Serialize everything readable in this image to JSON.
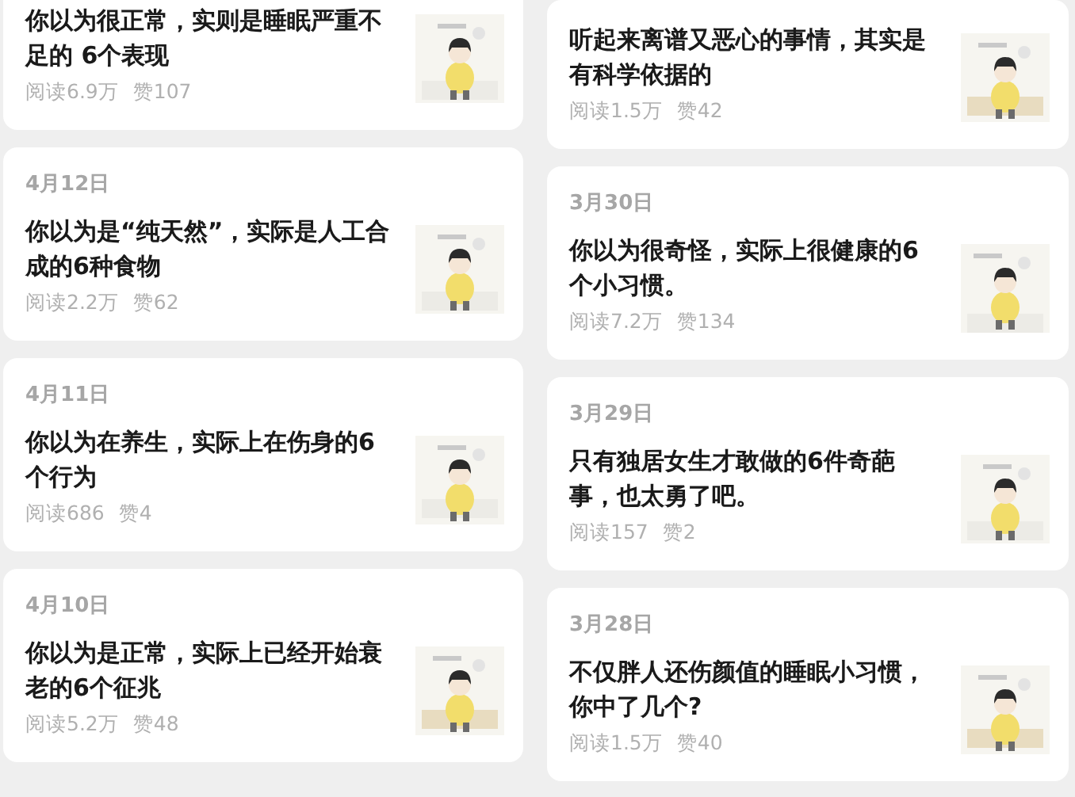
{
  "columns": [
    {
      "cards": [
        {
          "title": "你以为很正常，实则是睡眠严重不足的 6个表现",
          "reads": "阅读6.9万",
          "likes": "赞107"
        },
        {
          "date": "4月12日",
          "title": "你以为是“纯天然”，实际是人工合成的6种食物",
          "reads": "阅读2.2万",
          "likes": "赞62"
        },
        {
          "date": "4月11日",
          "title": "你以为在养生，实际上在伤身的6个行为",
          "reads": "阅读686",
          "likes": "赞4"
        },
        {
          "date": "4月10日",
          "title": "你以为是正常，实际上已经开始衰老的6个征兆",
          "reads": "阅读5.2万",
          "likes": "赞48"
        }
      ]
    },
    {
      "cards": [
        {
          "title": "听起来离谱又恶心的事情，其实是有科学依据的",
          "reads": "阅读1.5万",
          "likes": "赞42"
        },
        {
          "date": "3月30日",
          "title": "你以为很奇怪，实际上很健康的6个小习惯。",
          "reads": "阅读7.2万",
          "likes": "赞134"
        },
        {
          "date": "3月29日",
          "title": "只有独居女生才敢做的6件奇葩事，也太勇了吧。",
          "reads": "阅读157",
          "likes": "赞2"
        },
        {
          "date": "3月28日",
          "title": "不仅胖人还伤颜值的睡眠小习惯，你中了几个?",
          "reads": "阅读1.5万",
          "likes": "赞40"
        }
      ]
    }
  ]
}
